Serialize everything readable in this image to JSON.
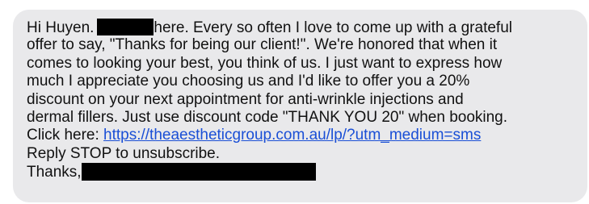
{
  "message": {
    "line1_greeting": "Hi Huyen.",
    "line1_rest": "here. Every so often I love to come up with a grateful",
    "line2": "offer to say, \"Thanks for being our client!\". We're honored that when it",
    "line3": "comes to looking your best, you think of us. I just want to express how",
    "line4": "much I appreciate you choosing us and I'd like to offer you a 20%",
    "line5": "discount on your next appointment for anti-wrinkle injections and",
    "line6": "dermal fillers. Just use discount code \"THANK YOU 20\" when booking.",
    "line7_prefix": "Click here:",
    "link_url": "https://theaestheticgroup.com.au/lp/?utm_medium=sms",
    "line8": "Reply STOP to unsubscribe.",
    "line9": "Thanks,"
  },
  "colors": {
    "bubble_background": "#e9e9eb",
    "text": "#111111",
    "link": "#1a4fd6",
    "redaction": "#000000"
  }
}
